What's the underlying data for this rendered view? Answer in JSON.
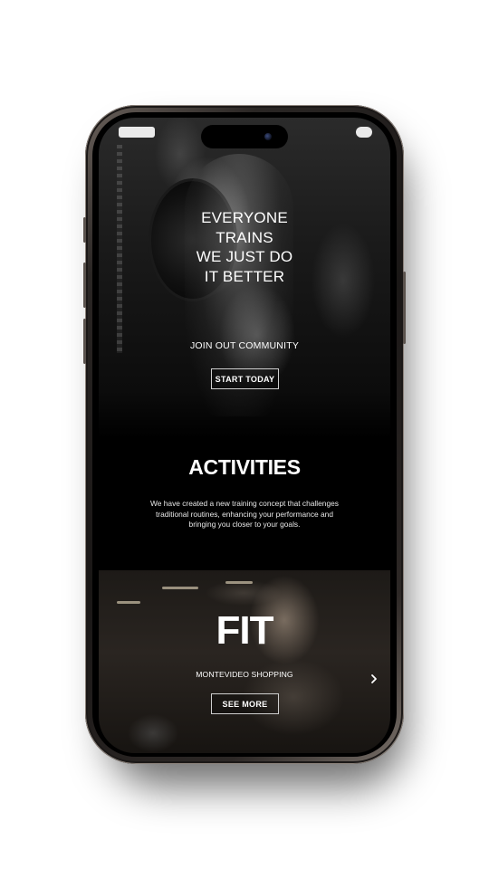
{
  "hero": {
    "title_lines": [
      "EVERYONE",
      "TRAINS",
      "WE JUST DO",
      "IT BETTER"
    ],
    "join_text": "JOIN OUT COMMUNITY",
    "cta_label": "START TODAY"
  },
  "activities": {
    "title": "ACTIVITIES",
    "description_lines": [
      "We have created a new training concept that challenges",
      "traditional routines, enhancing your performance and",
      "bringing you closer to your goals."
    ]
  },
  "slide": {
    "title": "FIT",
    "location": "MONTEVIDEO SHOPPING",
    "cta_label": "SEE MORE",
    "next_icon": "chevron-right-icon"
  },
  "colors": {
    "background": "#ffffff",
    "screen": "#000000",
    "text": "#ffffff",
    "button_border": "#cfcfcf"
  }
}
